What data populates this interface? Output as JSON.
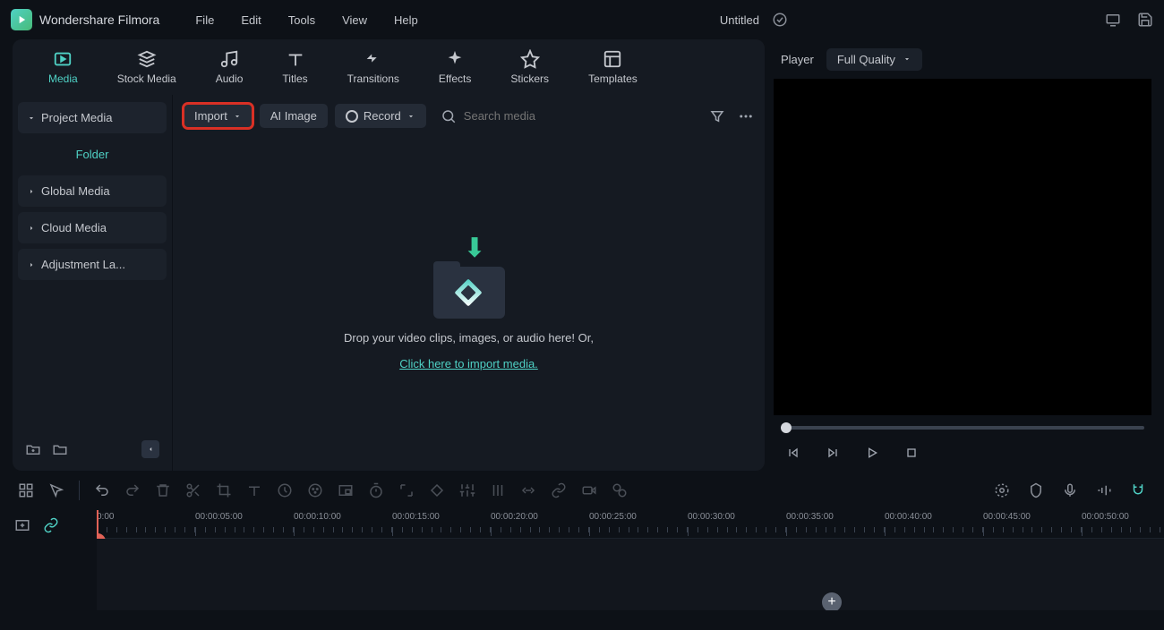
{
  "app_name": "Wondershare Filmora",
  "menubar": [
    "File",
    "Edit",
    "Tools",
    "View",
    "Help"
  ],
  "doc_title": "Untitled",
  "tabs": [
    {
      "label": "Media",
      "active": true
    },
    {
      "label": "Stock Media"
    },
    {
      "label": "Audio"
    },
    {
      "label": "Titles"
    },
    {
      "label": "Transitions"
    },
    {
      "label": "Effects"
    },
    {
      "label": "Stickers"
    },
    {
      "label": "Templates"
    }
  ],
  "sidebar": {
    "project_media": "Project Media",
    "folder": "Folder",
    "global_media": "Global Media",
    "cloud_media": "Cloud Media",
    "adjustment": "Adjustment La..."
  },
  "content_toolbar": {
    "import": "Import",
    "ai_image": "AI Image",
    "record": "Record",
    "search_placeholder": "Search media"
  },
  "dropzone": {
    "text": "Drop your video clips, images, or audio here! Or,",
    "link": "Click here to import media."
  },
  "player": {
    "label": "Player",
    "quality": "Full Quality"
  },
  "ruler": [
    "0:00",
    "00:00:05:00",
    "00:00:10:00",
    "00:00:15:00",
    "00:00:20:00",
    "00:00:25:00",
    "00:00:30:00",
    "00:00:35:00",
    "00:00:40:00",
    "00:00:45:00",
    "00:00:50:00"
  ]
}
